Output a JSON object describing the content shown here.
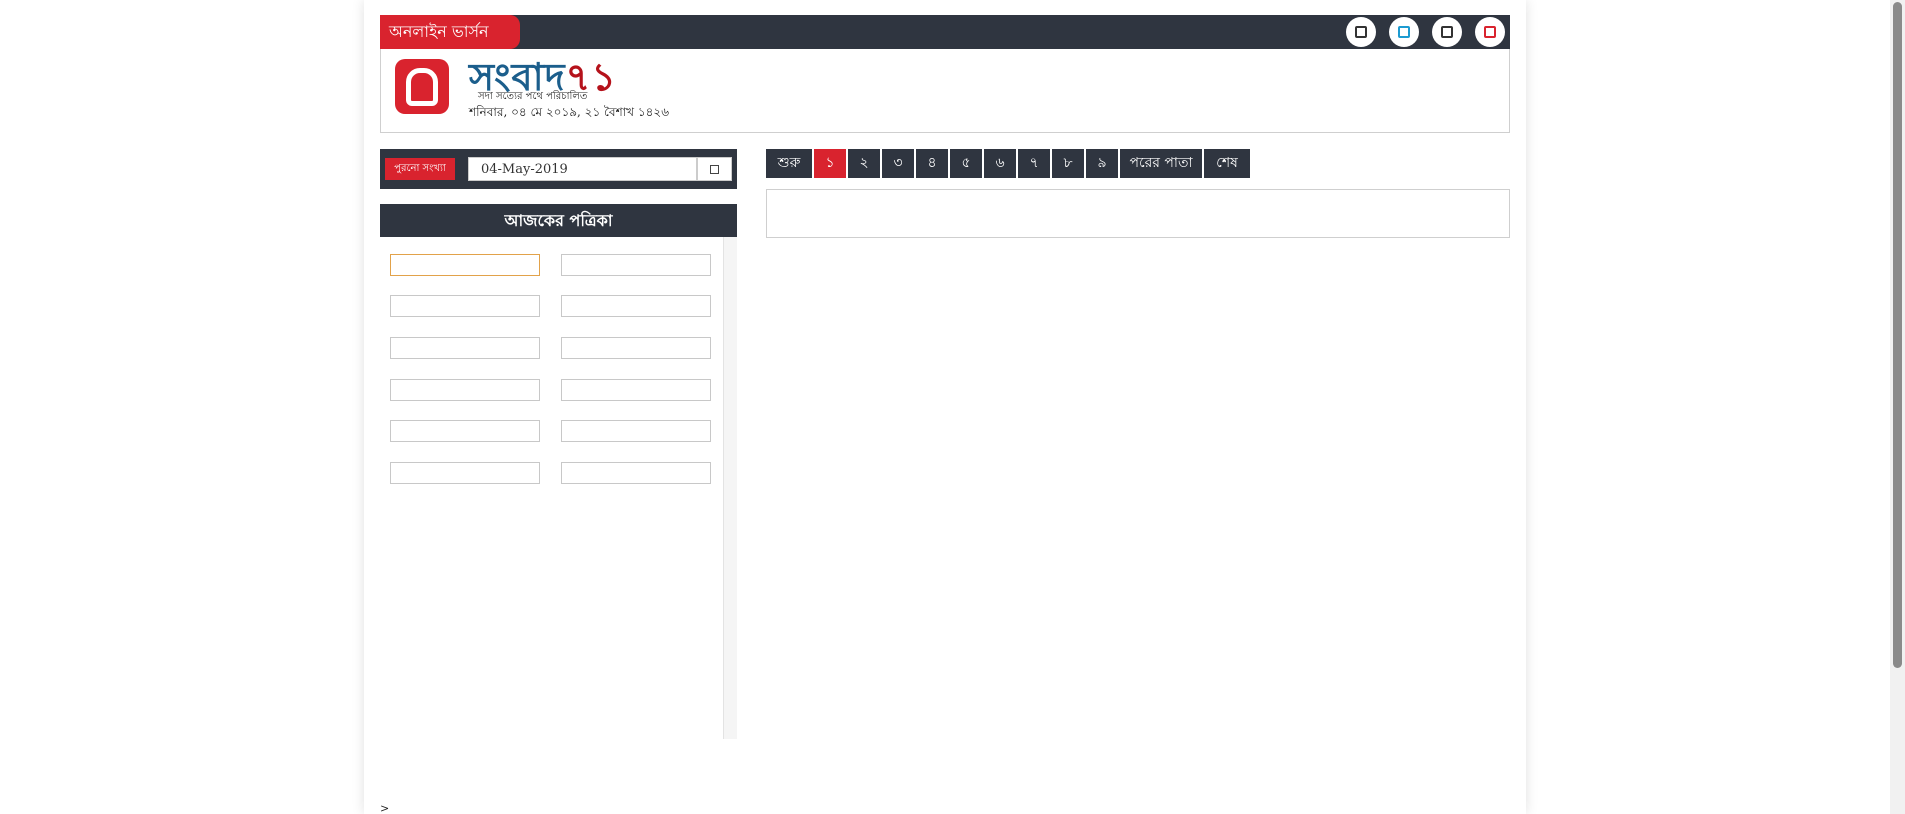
{
  "topbar": {
    "online_label": "অনলাইন ভার্সন",
    "social_icons": [
      "facebook-icon",
      "twitter-icon",
      "youtube-icon",
      "rss-icon"
    ]
  },
  "header": {
    "logo_main": "সংবাদ",
    "logo_accent": "৭১",
    "tagline": "সদা সত্যের পথে পরিচালিত",
    "date_line": "শনিবার, ০৪ মে ২০১৯, ২১ বৈশাখ ১৪২৬"
  },
  "archive": {
    "label": "পুরনো সংখ্যা",
    "date_value": "04-May-2019"
  },
  "today": {
    "title": "আজকের পত্রিকা"
  },
  "pagination": {
    "first": "শুরু",
    "pages": [
      "১",
      "২",
      "৩",
      "৪",
      "৫",
      "৬",
      "৭",
      "৮",
      "৯"
    ],
    "active_page": "১",
    "next": "পরের পাতা",
    "last": "শেষ"
  },
  "footer": {
    "mark": ">"
  }
}
